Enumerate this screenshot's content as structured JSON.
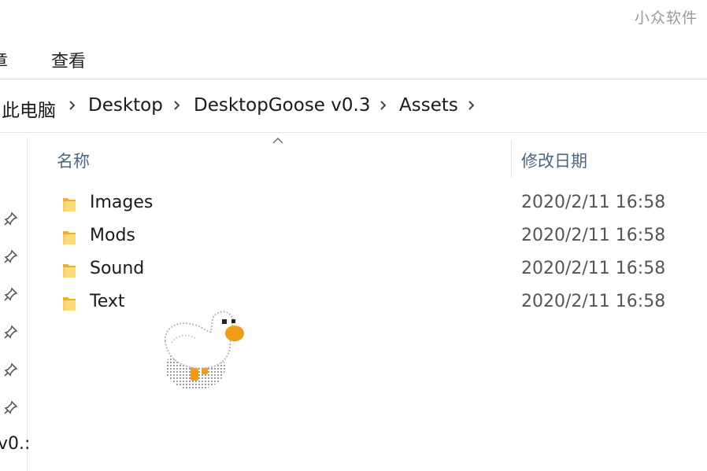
{
  "watermark": "小众软件",
  "ribbon": {
    "tabs": [
      "章",
      "查看"
    ]
  },
  "address": {
    "breadcrumbs": [
      "此电脑",
      "Desktop",
      "DesktopGoose v0.3",
      "Assets"
    ]
  },
  "nav": {
    "pinned_count": 6,
    "partial_item": "v0.:"
  },
  "columns": {
    "name": "名称",
    "date": "修改日期"
  },
  "files": [
    {
      "name": "Images",
      "date": "2020/2/11 16:58",
      "type": "folder"
    },
    {
      "name": "Mods",
      "date": "2020/2/11 16:58",
      "type": "folder"
    },
    {
      "name": "Sound",
      "date": "2020/2/11 16:58",
      "type": "folder"
    },
    {
      "name": "Text",
      "date": "2020/2/11 16:58",
      "type": "folder"
    }
  ],
  "icons": {
    "folder": "folder-icon",
    "pin": "pin-icon",
    "separator": "chevron-right-icon",
    "sort": "sort-arrow-icon",
    "goose": "desktop-goose"
  },
  "colors": {
    "header_text": "#4d6582",
    "folder_yellow": "#f7c948",
    "goose_beak": "#f39a16"
  }
}
